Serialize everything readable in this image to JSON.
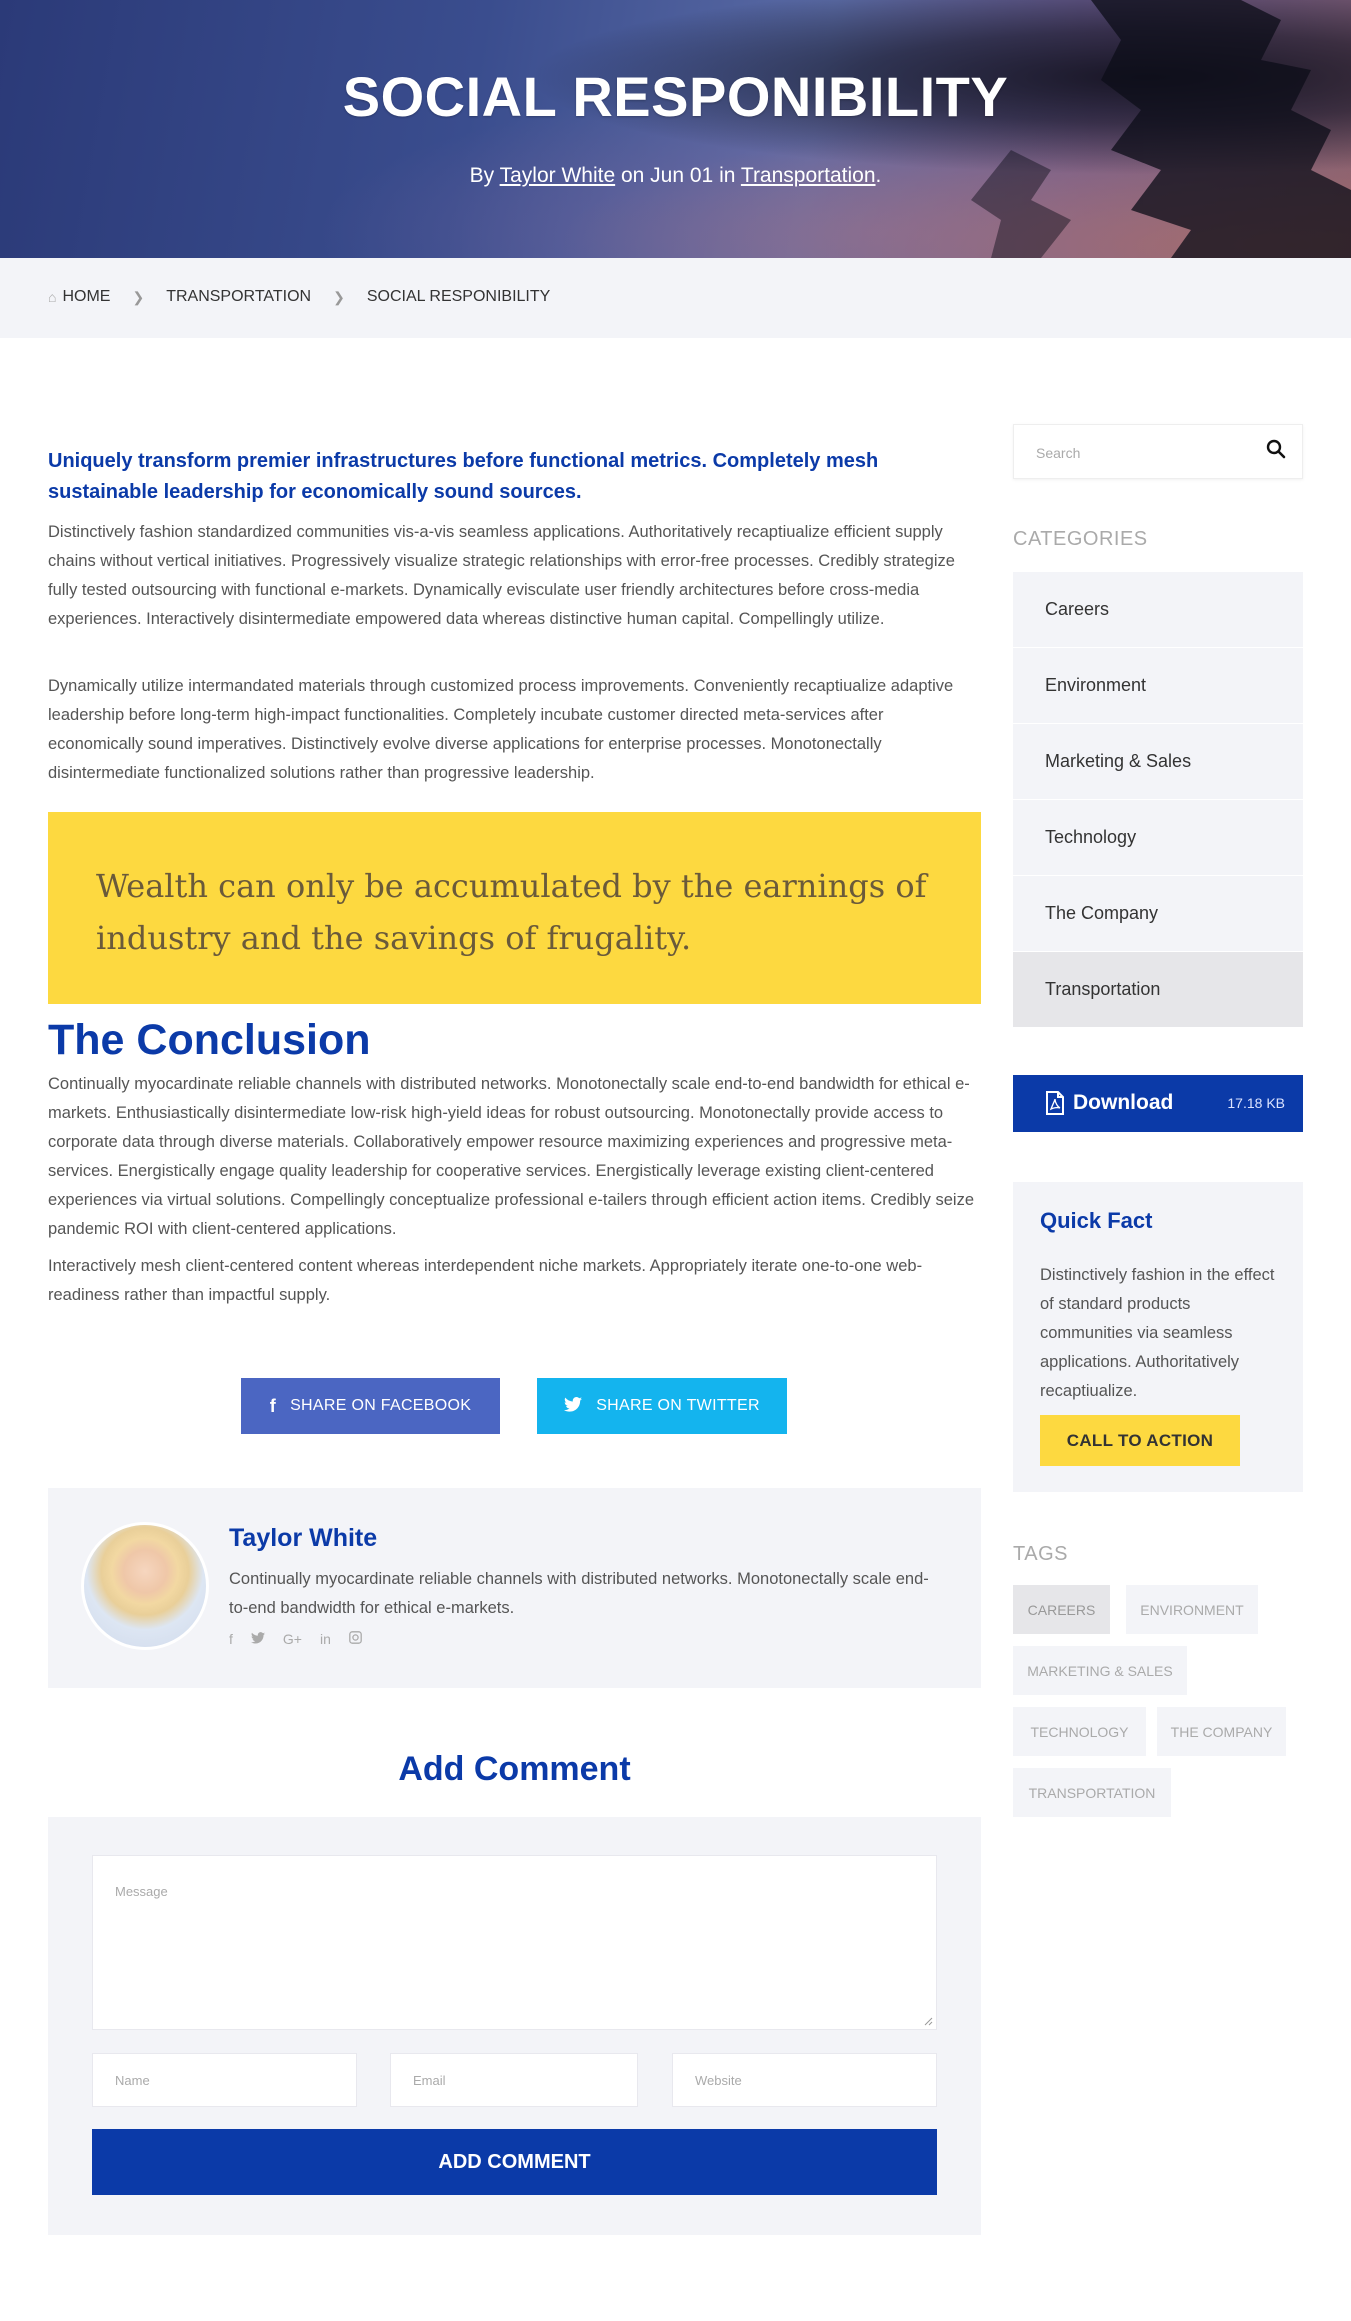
{
  "hero": {
    "title": "SOCIAL RESPONIBILITY",
    "by": "By",
    "author": "Taylor White",
    "on_date": "on Jun 01 in",
    "category": "Transportation",
    "period": "."
  },
  "breadcrumb": [
    "HOME",
    "TRANSPORTATION",
    "SOCIAL RESPONIBILITY"
  ],
  "article": {
    "lead": "Uniquely transform premier infrastructures before functional metrics. Completely mesh sustainable leadership for economically sound sources.",
    "paragraphs": [
      "Distinctively fashion standardized communities vis-a-vis seamless applications. Authoritatively recaptiualize efficient supply chains without vertical initiatives. Progressively visualize strategic relationships with error-free processes. Credibly strategize fully tested outsourcing with functional e-markets. Dynamically evisculate user friendly architectures before cross-media experiences. Interactively disintermediate empowered data whereas distinctive human capital. Compellingly utilize.",
      "Dynamically utilize intermandated materials through customized process improvements. Conveniently recaptiualize adaptive leadership before long-term high-impact functionalities. Completely incubate customer directed meta-services after economically sound imperatives. Distinctively evolve diverse applications for enterprise processes. Monotonectally disintermediate functionalized solutions rather than progressive leadership."
    ],
    "quote": "Wealth can only be accumulated by the earnings of industry and the savings of frugality.",
    "conclusion_title": "The Conclusion",
    "conclusion_paragraphs": [
      "Continually myocardinate reliable channels with distributed networks. Monotonectally scale end-to-end bandwidth for ethical e-markets. Enthusiastically disintermediate low-risk high-yield ideas for robust outsourcing. Monotonectally provide access to corporate data through diverse materials. Collaboratively empower resource maximizing experiences and progressive meta-services. Energistically engage quality leadership for cooperative services. Energistically leverage existing client-centered experiences via virtual solutions. Compellingly conceptualize professional e-tailers through efficient action items. Credibly seize pandemic ROI with client-centered applications.",
      "Interactively mesh client-centered content whereas interdependent niche markets. Appropriately iterate one-to-one web-readiness rather than impactful supply."
    ]
  },
  "share": {
    "facebook": "SHARE ON FACEBOOK",
    "twitter": "SHARE ON TWITTER"
  },
  "author_box": {
    "name": "Taylor White",
    "bio": "Continually myocardinate reliable channels with distributed networks. Monotonectally scale end-to-end bandwidth for ethical e-markets."
  },
  "comment": {
    "title": "Add Comment",
    "message_placeholder": "Message",
    "name_placeholder": "Name",
    "email_placeholder": "Email",
    "website_placeholder": "Website",
    "submit": "ADD COMMENT"
  },
  "sidebar": {
    "search_placeholder": "Search",
    "categories_title": "CATEGORIES",
    "categories": [
      "Careers",
      "Environment",
      "Marketing & Sales",
      "Technology",
      "The Company",
      "Transportation"
    ],
    "active_category": "Transportation",
    "download": {
      "label": "Download",
      "size": "17.18 KB"
    },
    "quick_fact": {
      "title": "Quick Fact",
      "text": "Distinctively fashion in the effect of standard products communities via seamless applications. Authoritatively recaptiualize.",
      "cta": "CALL TO ACTION"
    },
    "tags_title": "TAGS",
    "tags": [
      "CAREERS",
      "ENVIRONMENT",
      "MARKETING & SALES",
      "TECHNOLOGY",
      "THE COMPANY",
      "TRANSPORTATION"
    ],
    "active_tag": "CAREERS"
  },
  "colors": {
    "primary": "#0b3aa8",
    "accent_yellow": "#fdd940",
    "facebook": "#4b66c2",
    "twitter": "#14b4ee",
    "panel": "#f3f4f8"
  },
  "icons": {
    "home": "home-icon",
    "breadcrumb_sep": "chevron-right-icon",
    "search": "search-icon",
    "download": "pdf-file-icon",
    "share_facebook": "facebook-icon",
    "share_twitter": "twitter-icon",
    "author_social": [
      "facebook-icon",
      "twitter-icon",
      "google-plus-icon",
      "linkedin-icon",
      "instagram-icon"
    ]
  }
}
